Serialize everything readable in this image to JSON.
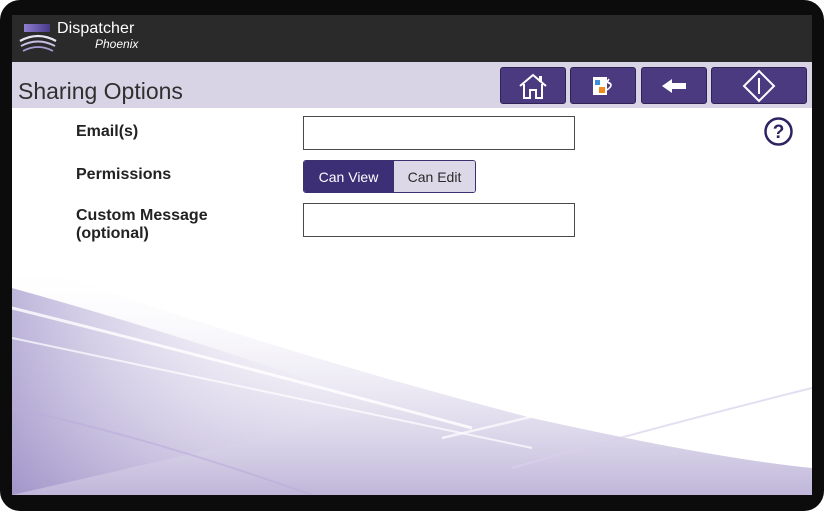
{
  "brand": {
    "name": "Dispatcher",
    "sub": "Phoenix"
  },
  "page": {
    "title": "Sharing Options"
  },
  "toolbar": {
    "buttons": [
      {
        "icon": "home-icon"
      },
      {
        "icon": "workflow-icon"
      },
      {
        "icon": "back-arrow-icon"
      },
      {
        "icon": "start-icon"
      }
    ]
  },
  "form": {
    "email_label": "Email(s)",
    "email_value": "",
    "permissions_label": "Permissions",
    "permissions_options": [
      "Can View",
      "Can Edit"
    ],
    "permissions_selected": "Can View",
    "message_label_line1": "Custom Message",
    "message_label_line2": "(optional)",
    "message_value": ""
  },
  "colors": {
    "accent": "#3d2f76",
    "toolbar_button": "#4b3a80",
    "title_bar": "#d9d4e5",
    "top_bar": "#2a2a2a"
  }
}
